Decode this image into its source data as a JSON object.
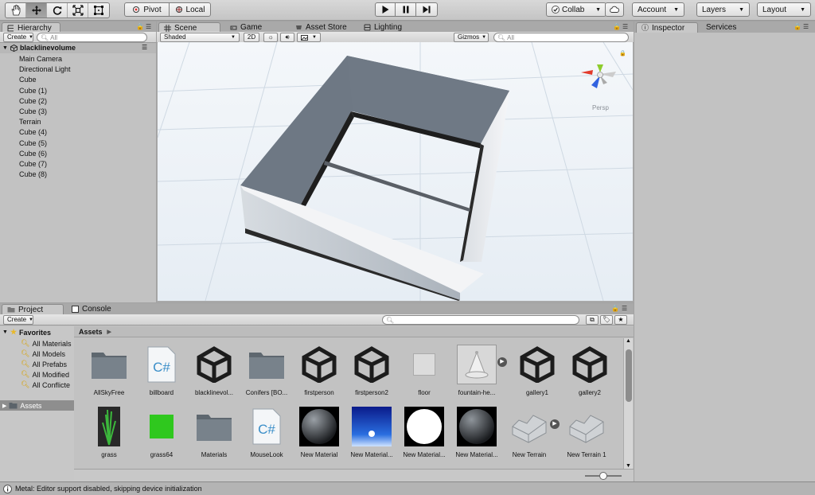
{
  "toolbar": {
    "tools": [
      "hand-tool-icon",
      "move-tool-icon",
      "rotate-tool-icon",
      "scale-tool-icon",
      "rect-tool-icon"
    ],
    "pivot_label": "Pivot",
    "local_label": "Local",
    "collab_label": "Collab",
    "account_label": "Account",
    "layers_label": "Layers",
    "layout_label": "Layout"
  },
  "hierarchy": {
    "tab_label": "Hierarchy",
    "create_label": "Create",
    "search_placeholder": "All",
    "scene_name": "blacklinevolume",
    "items": [
      "Main Camera",
      "Directional Light",
      "Cube",
      "Cube (1)",
      "Cube (2)",
      "Cube (3)",
      "Terrain",
      "Cube (4)",
      "Cube (5)",
      "Cube (6)",
      "Cube (7)",
      "Cube (8)"
    ]
  },
  "scene_tabs": {
    "scene": "Scene",
    "game": "Game",
    "asset_store": "Asset Store",
    "lighting": "Lighting"
  },
  "scene_bar": {
    "shading": "Shaded",
    "mode_2d": "2D",
    "gizmos": "Gizmos",
    "search_placeholder": "All"
  },
  "scene": {
    "projection_label": "Persp"
  },
  "inspector": {
    "tab_label": "Inspector",
    "services_label": "Services"
  },
  "project": {
    "tab_label": "Project",
    "console_label": "Console",
    "create_label": "Create",
    "favorites_label": "Favorites",
    "favorites": [
      "All Materials",
      "All Models",
      "All Prefabs",
      "All Modified",
      "All Conflicte"
    ],
    "assets_root": "Assets",
    "breadcrumb": "Assets",
    "assets_row1": [
      "AllSkyFree",
      "billboard",
      "blacklinevol...",
      "Conifers [BO...",
      "firstperson",
      "firstperson2",
      "floor",
      "fountain-he...",
      "gallery1",
      "gallery2"
    ],
    "assets_row2": [
      "grass",
      "grass64",
      "Materials",
      "MouseLook",
      "New Material",
      "New Material...",
      "New Material...",
      "New Material...",
      "New Terrain",
      "New Terrain 1"
    ],
    "zoom_level": 0.5
  },
  "status": {
    "message": "Metal: Editor support disabled, skipping device initialization"
  },
  "colors": {
    "panel_bg": "#c2c2c2",
    "tab_bg": "#a9a9a9",
    "wall_top": "#6e7884",
    "wall_front": "#c9ced4",
    "folder": "#6f7880"
  }
}
